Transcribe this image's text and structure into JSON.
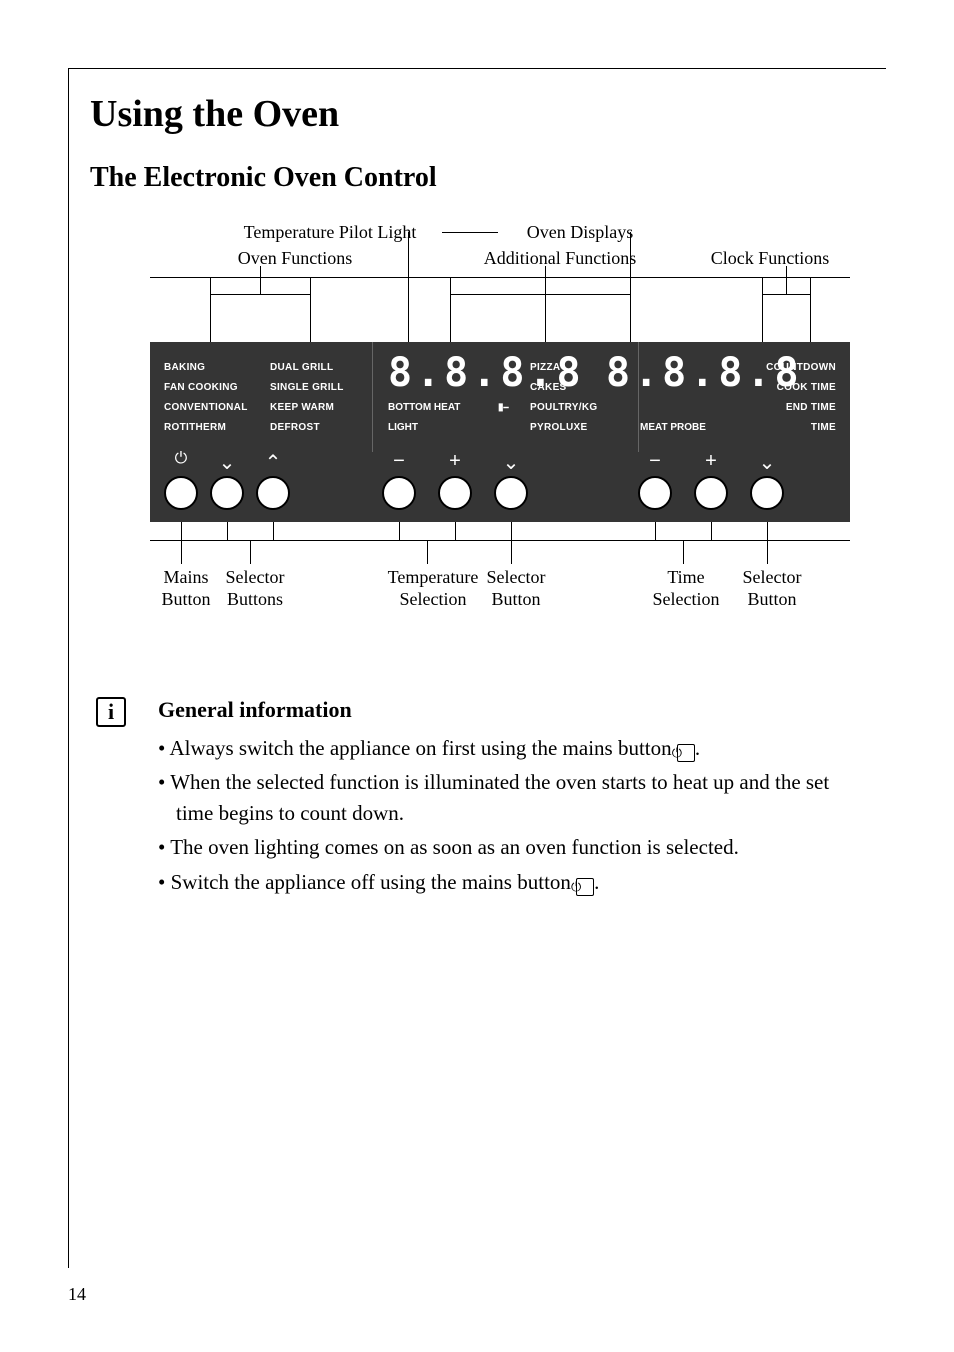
{
  "page_number": "14",
  "heading1": "Using the Oven",
  "heading2": "The Electronic Oven Control",
  "diagram": {
    "top_labels": {
      "temp_pilot": "Temperature Pilot Light",
      "oven_funcs": "Oven Functions",
      "oven_displays": "Oven Displays",
      "additional": "Additional Functions",
      "clock": "Clock Functions"
    },
    "panel": {
      "col1": [
        "BAKING",
        "FAN COOKING",
        "CONVENTIONAL",
        "ROTITHERM"
      ],
      "col2": [
        "DUAL GRILL",
        "SINGLE GRILL",
        "KEEP WARM",
        "DEFROST"
      ],
      "display1": "8.8.8.8",
      "display1_sub_left": "BOTTOM HEAT",
      "display1_sub_right": "LIGHT",
      "col3": [
        "PIZZA",
        "CAKES",
        "POULTRY/KG",
        "PYROLUXE"
      ],
      "display2": "8.8.8.8",
      "display2_sub": "MEAT PROBE",
      "col4": [
        "COUNTDOWN",
        "COOK TIME",
        "END TIME",
        "TIME"
      ]
    },
    "bottom_labels": {
      "mains": "Mains\nButton",
      "selector1": "Selector\nButtons",
      "temp_sel": "Temperature\nSelection",
      "selector2": "Selector\nButton",
      "time_sel": "Time\nSelection",
      "selector3": "Selector\nButton"
    }
  },
  "general_info": {
    "heading": "General information",
    "bullets": [
      "Always switch the appliance on first using the mains button ⓘ.",
      "When the selected function is illuminated the oven starts to heat up and the set time begins to count down.",
      "The oven lighting comes on as soon as an oven function is selected.",
      "Switch the appliance off using the mains button ⓘ."
    ]
  }
}
